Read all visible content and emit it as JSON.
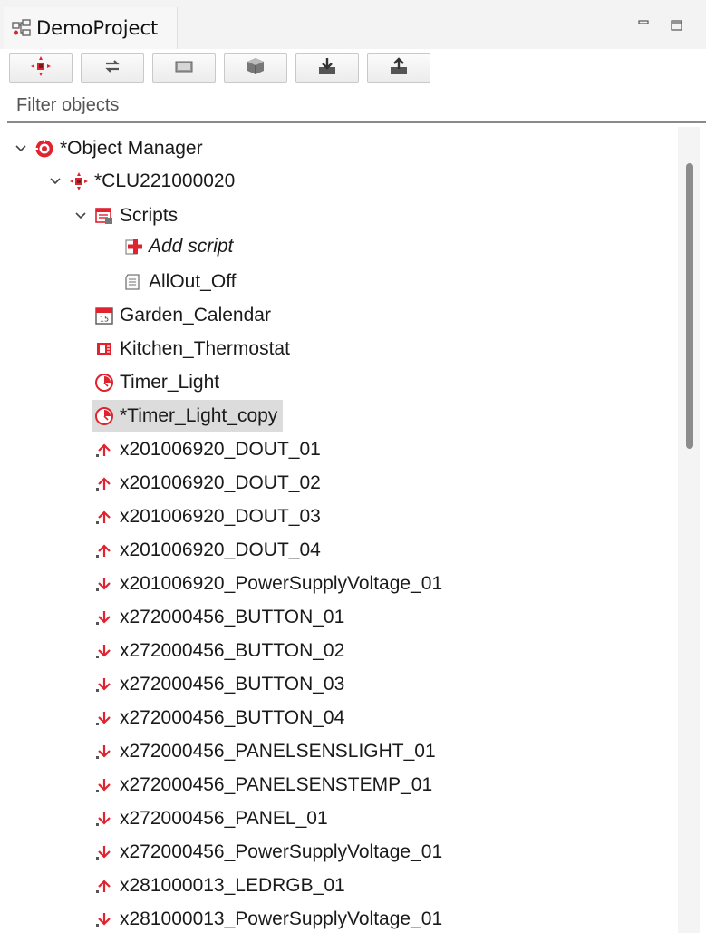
{
  "tab": {
    "title": "DemoProject",
    "icon": "project-icon"
  },
  "window_controls": {
    "minimize": "minimize-icon",
    "maximize": "maximize-icon"
  },
  "toolbar": {
    "buttons": [
      {
        "name": "clu-icon"
      },
      {
        "name": "sync-icon"
      },
      {
        "name": "panel-icon"
      },
      {
        "name": "cube-icon"
      },
      {
        "name": "import-icon"
      },
      {
        "name": "export-icon"
      }
    ]
  },
  "filter": {
    "placeholder": "Filter objects",
    "value": ""
  },
  "tree": {
    "items": [
      {
        "label": "*Object Manager",
        "icon": "object-manager-icon",
        "level": 0,
        "expanded": true
      },
      {
        "label": "*CLU221000020",
        "icon": "clu-icon",
        "level": 1,
        "expanded": true
      },
      {
        "label": "Scripts",
        "icon": "scripts-folder-icon",
        "level": 2,
        "expanded": true
      },
      {
        "label": "Add script",
        "icon": "add-script-icon",
        "level": 3,
        "italic": true
      },
      {
        "label": "AllOut_Off",
        "icon": "script-icon",
        "level": 3
      },
      {
        "label": "Garden_Calendar",
        "icon": "calendar-icon",
        "level": 2
      },
      {
        "label": "Kitchen_Thermostat",
        "icon": "thermostat-icon",
        "level": 2
      },
      {
        "label": "Timer_Light",
        "icon": "timer-icon",
        "level": 2
      },
      {
        "label": "*Timer_Light_copy",
        "icon": "timer-icon",
        "level": 2,
        "selected": true
      },
      {
        "label": "x201006920_DOUT_01",
        "icon": "output-icon",
        "level": 2
      },
      {
        "label": "x201006920_DOUT_02",
        "icon": "output-icon",
        "level": 2
      },
      {
        "label": "x201006920_DOUT_03",
        "icon": "output-icon",
        "level": 2
      },
      {
        "label": "x201006920_DOUT_04",
        "icon": "output-icon",
        "level": 2
      },
      {
        "label": "x201006920_PowerSupplyVoltage_01",
        "icon": "input-icon",
        "level": 2
      },
      {
        "label": "x272000456_BUTTON_01",
        "icon": "input-icon",
        "level": 2
      },
      {
        "label": "x272000456_BUTTON_02",
        "icon": "input-icon",
        "level": 2
      },
      {
        "label": "x272000456_BUTTON_03",
        "icon": "input-icon",
        "level": 2
      },
      {
        "label": "x272000456_BUTTON_04",
        "icon": "input-icon",
        "level": 2
      },
      {
        "label": "x272000456_PANELSENSLIGHT_01",
        "icon": "input-icon",
        "level": 2
      },
      {
        "label": "x272000456_PANELSENSTEMP_01",
        "icon": "input-icon",
        "level": 2
      },
      {
        "label": "x272000456_PANEL_01",
        "icon": "input-icon",
        "level": 2
      },
      {
        "label": "x272000456_PowerSupplyVoltage_01",
        "icon": "input-icon",
        "level": 2
      },
      {
        "label": "x281000013_LEDRGB_01",
        "icon": "output-icon",
        "level": 2
      },
      {
        "label": "x281000013_PowerSupplyVoltage_01",
        "icon": "input-icon",
        "level": 2
      }
    ]
  },
  "colors": {
    "accent_red": "#e0232e",
    "selection": "#dcdcdc",
    "scrollbar_thumb": "#8c8c8c"
  }
}
